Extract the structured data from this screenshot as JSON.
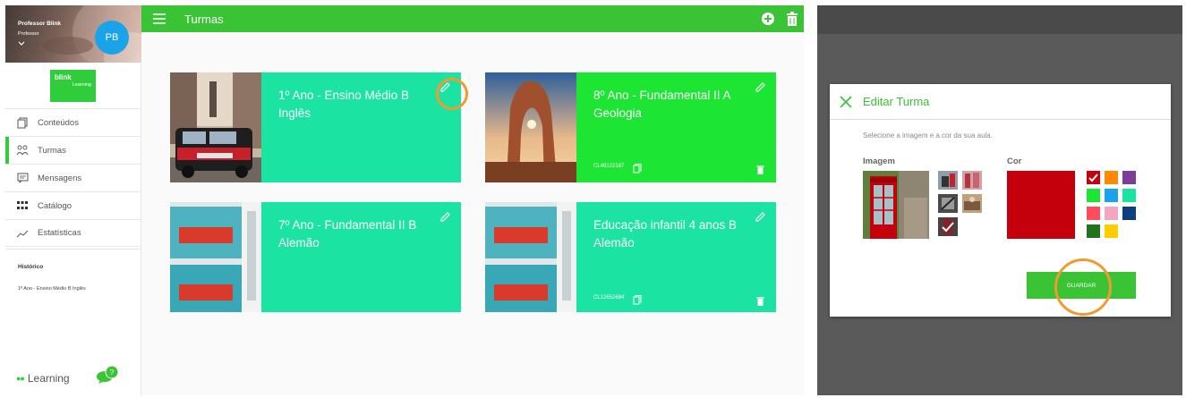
{
  "sidebar": {
    "profile_name": "Professor Blink",
    "profile_role": "Professor",
    "avatar_initials": "PB",
    "brand": {
      "name": "blink",
      "sub": "Learning"
    },
    "items": [
      {
        "label": "Conteúdos",
        "icon": "copy-icon"
      },
      {
        "label": "Turmas",
        "icon": "people-icon",
        "active": true
      },
      {
        "label": "Mensagens",
        "icon": "message-icon"
      },
      {
        "label": "Catálogo",
        "icon": "grid-icon"
      },
      {
        "label": "Estatísticas",
        "icon": "chart-line-icon"
      }
    ],
    "history_title": "Histórico",
    "history_items": [
      "1º Ano - Ensino Médio B Inglês"
    ],
    "footer_text": "Learning",
    "chat_badge": "?"
  },
  "topbar": {
    "title": "Turmas"
  },
  "cards": [
    {
      "line1": "1º Ano - Ensino Médio B",
      "line2": "Inglês",
      "code": "",
      "color": "#1be3a2",
      "image": "london-street"
    },
    {
      "line1": "8º Ano - Fundamental II A",
      "line2": "Geologia",
      "code": "CL49122187",
      "color": "#1de533",
      "image": "arch-rock"
    },
    {
      "line1": "7º Ano - Fundamental II B",
      "line2": "Alemão",
      "code": "",
      "color": "#1be3a2",
      "image": "berlin-postcards"
    },
    {
      "line1": "Educação infantil 4 anos B",
      "line2": "Alemão",
      "code": "CL12652684",
      "color": "#1be3a2",
      "image": "berlin-postcards"
    }
  ],
  "modal": {
    "title": "Editar Turma",
    "subtitle": "Selecione a imagem e a cor da sua aula.",
    "image_label": "Imagem",
    "color_label": "Cor",
    "save_label": "GUARDAR",
    "selected_color": "#c4000c",
    "swatches": [
      "#c4000c",
      "#ff8a00",
      "#7d3c98",
      "#1de533",
      "#1aa3e8",
      "#1be3a2",
      "#ff4d5e",
      "#f3a6c0",
      "#0d3f80",
      "#23731e",
      "#ffcc00"
    ]
  }
}
